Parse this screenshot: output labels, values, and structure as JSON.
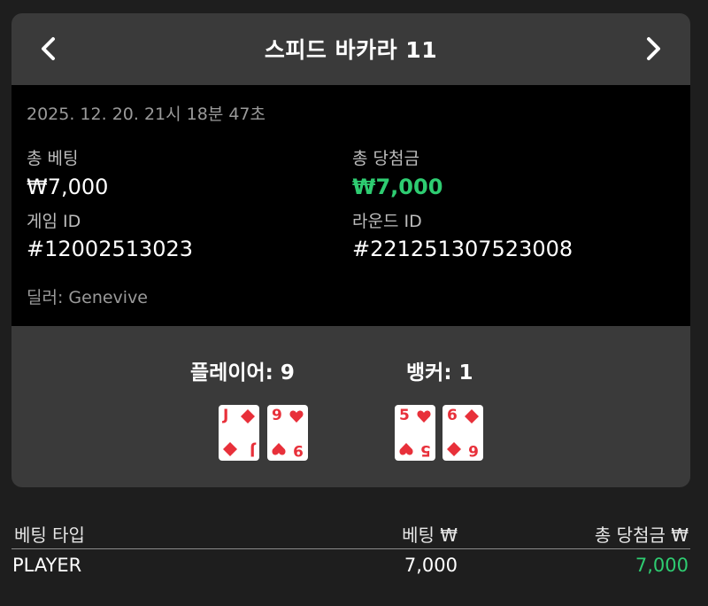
{
  "header": {
    "title": "스피드 바카라 11",
    "prev_icon": "chevron-left-icon",
    "next_icon": "chevron-right-icon"
  },
  "info": {
    "datetime": "2025. 12. 20. 21시 18분 47초",
    "total_bet_label": "총 베팅",
    "total_bet_value": "₩7,000",
    "total_win_label": "총 당첨금",
    "total_win_value": "₩7,000",
    "game_id_label": "게임 ID",
    "game_id_value": "#12002513023",
    "round_id_label": "라운드 ID",
    "round_id_value": "#221251307523008",
    "dealer": "딜러: Genevive"
  },
  "hands": {
    "player_label": "플레이어: 9",
    "banker_label": "뱅커: 1",
    "player_cards": [
      {
        "rank": "J",
        "suit": "diamond"
      },
      {
        "rank": "9",
        "suit": "heart"
      }
    ],
    "banker_cards": [
      {
        "rank": "5",
        "suit": "heart"
      },
      {
        "rank": "6",
        "suit": "diamond"
      }
    ]
  },
  "bets_table": {
    "headers": [
      "베팅 타입",
      "베팅 ₩",
      "총 당첨금 ₩"
    ],
    "rows": [
      {
        "type": "PLAYER",
        "bet": "7,000",
        "win": "7,000"
      }
    ]
  },
  "colors": {
    "win_green": "#2ecc71",
    "card_red": "#e8303a",
    "panel": "#3a3a3a",
    "background": "#1e1e1e"
  }
}
